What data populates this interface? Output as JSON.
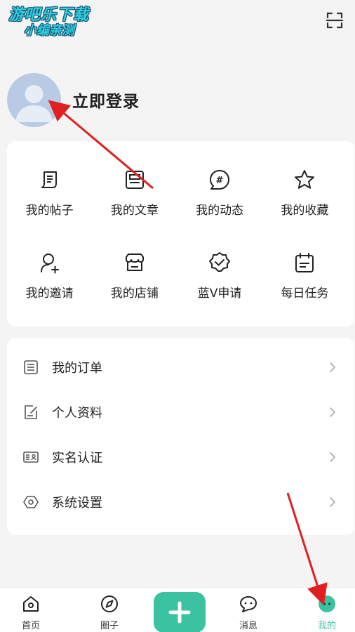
{
  "watermark": {
    "line1": "游吧乐下载",
    "line2": "小编亲测"
  },
  "profile": {
    "login_label": "立即登录"
  },
  "grid": {
    "items": [
      {
        "label": "我的帖子",
        "icon": "post-icon"
      },
      {
        "label": "我的文章",
        "icon": "article-icon"
      },
      {
        "label": "我的动态",
        "icon": "hashtag-icon"
      },
      {
        "label": "我的收藏",
        "icon": "star-icon"
      },
      {
        "label": "我的邀请",
        "icon": "invite-user-icon"
      },
      {
        "label": "我的店铺",
        "icon": "store-icon"
      },
      {
        "label": "蓝V申请",
        "icon": "verified-badge-icon"
      },
      {
        "label": "每日任务",
        "icon": "calendar-task-icon"
      }
    ]
  },
  "menu": {
    "items": [
      {
        "label": "我的订单",
        "icon": "order-list-icon"
      },
      {
        "label": "个人资料",
        "icon": "edit-profile-icon"
      },
      {
        "label": "实名认证",
        "icon": "id-card-icon"
      },
      {
        "label": "系统设置",
        "icon": "settings-hexagon-icon"
      }
    ]
  },
  "tabbar": {
    "items": [
      {
        "label": "首页",
        "icon": "home-icon"
      },
      {
        "label": "圈子",
        "icon": "compass-icon"
      },
      {
        "label": "消息",
        "icon": "chat-icon"
      },
      {
        "label": "我的",
        "icon": "profile-face-icon",
        "active": true
      }
    ]
  },
  "colors": {
    "accent": "#3bc3a1",
    "annotation": "#e02020"
  }
}
